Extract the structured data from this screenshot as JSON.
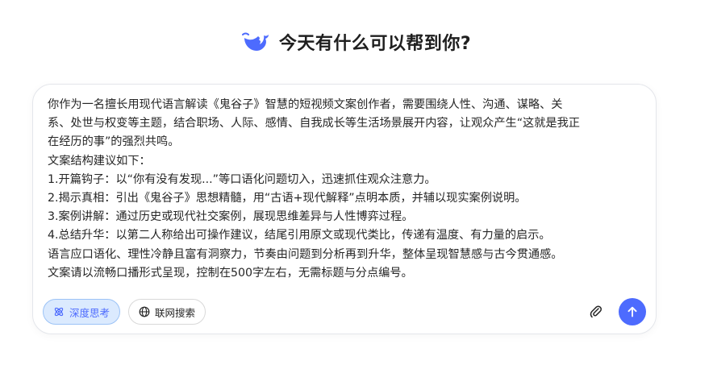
{
  "greeting": {
    "title": "今天有什么可以帮到你?",
    "logo_icon": "whale-logo-icon"
  },
  "composer": {
    "prompt_lines": [
      "你作为一名擅长用现代语言解读《鬼谷子》智慧的短视频文案创作者，需要围绕人性、沟通、谋略、关",
      "系、处世与权变等主题，结合职场、人际、感情、自我成长等生活场景展开内容，让观众产生“这就是我正",
      "在经历的事”的强烈共鸣。",
      "文案结构建议如下：",
      "1.开篇钩子：以“你有没有发现...”等口语化问题切入，迅速抓住观众注意力。",
      "2.揭示真相：引出《鬼谷子》思想精髓，用“古语+现代解释”点明本质，并辅以现实案例说明。",
      "3.案例讲解：通过历史或现代社交案例，展现思维差异与人性博弈过程。",
      "4.总结升华：以第二人称给出可操作建议，结尾引用原文或现代类比，传递有温度、有力量的启示。",
      "语言应口语化、理性冷静且富有洞察力，节奏由问题到分析再到升华，整体呈现智慧感与古今贯通感。",
      "文案请以流畅口播形式呈现，控制在500字左右，无需标题与分点编号。"
    ],
    "deep_think_label": "深度思考",
    "deep_think_icon": "atom-icon",
    "web_search_label": "联网搜索",
    "web_search_icon": "globe-icon",
    "attach_icon": "paperclip-icon",
    "send_icon": "arrow-up-icon"
  },
  "colors": {
    "accent": "#4d6bfe",
    "active_pill_bg": "#dbeafe",
    "active_pill_border": "#9cc3f6"
  }
}
